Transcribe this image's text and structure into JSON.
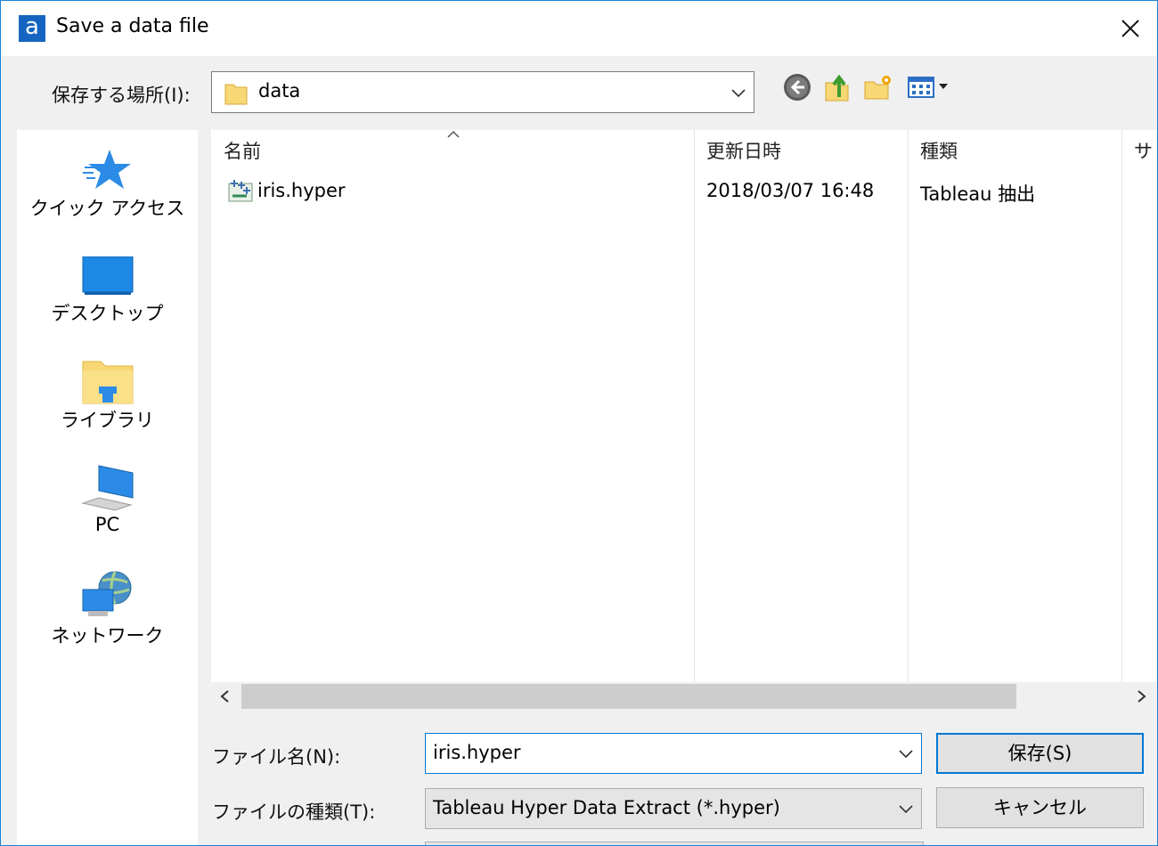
{
  "window": {
    "title": "Save a data file",
    "app_icon_letter": "a"
  },
  "location": {
    "label": "保存する場所(I):",
    "value": "data"
  },
  "places": [
    {
      "label": "クイック アクセス",
      "icon": "quick-access-star-icon"
    },
    {
      "label": "デスクトップ",
      "icon": "desktop-icon"
    },
    {
      "label": "ライブラリ",
      "icon": "library-folder-icon"
    },
    {
      "label": "PC",
      "icon": "computer-icon"
    },
    {
      "label": "ネットワーク",
      "icon": "network-icon"
    }
  ],
  "columns": {
    "name": "名前",
    "modified": "更新日時",
    "type": "種類",
    "size": "サ"
  },
  "files": [
    {
      "name": "iris.hyper",
      "modified": "2018/03/07 16:48",
      "type": "Tableau 抽出",
      "icon": "hyper-file-icon"
    }
  ],
  "filename": {
    "label": "ファイル名(N):",
    "value": "iris.hyper"
  },
  "filetype": {
    "label": "ファイルの種類(T):",
    "value": "Tableau Hyper Data Extract (*.hyper)"
  },
  "buttons": {
    "save": "保存(S)",
    "cancel": "キャンセル"
  },
  "colors": {
    "accent": "#0078d7",
    "folder": "#f8d775",
    "window_border": "#1883d7"
  }
}
